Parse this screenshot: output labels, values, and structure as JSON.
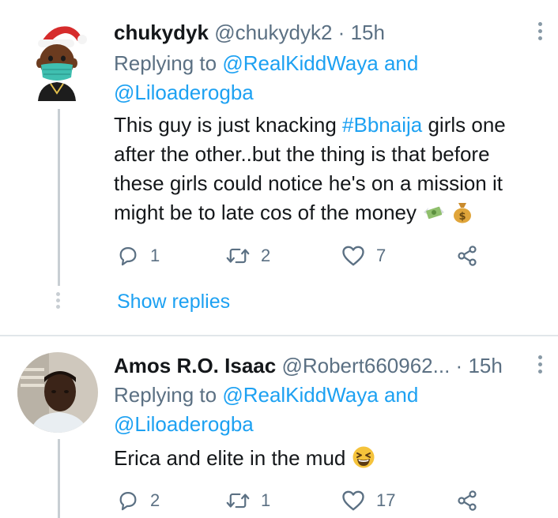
{
  "tweets": [
    {
      "name": "chukydyk",
      "handle": "@chukydyk2",
      "separator": "·",
      "time": "15h",
      "replying_prefix": "Replying to",
      "replying_user1": "@RealKiddWaya",
      "replying_and": "and",
      "replying_user2": "@Liloaderogba",
      "text_before_hashtag": "This guy is just knacking",
      "hashtag": "#Bbnaija",
      "text_after_hashtag": "girls one after the other..but the thing is that before these girls could notice he's on a mission it might be to late cos of the money",
      "emojis": [
        "money-with-wings-emoji",
        "money-bag-emoji"
      ],
      "reply_count": "1",
      "retweet_count": "2",
      "like_count": "7",
      "show_replies": "Show replies"
    },
    {
      "name": "Amos R.O. Isaac",
      "handle": "@Robert660962...",
      "separator": "·",
      "time": "15h",
      "replying_prefix": "Replying to",
      "replying_user1": "@RealKiddWaya",
      "replying_and": "and",
      "replying_user2": "@Liloaderogba",
      "text": "Erica and elite in the mud",
      "emojis": [
        "grinning-squinting-face-emoji"
      ],
      "reply_count": "2",
      "retweet_count": "1",
      "like_count": "17"
    }
  ],
  "colors": {
    "link": "#1da1f2",
    "secondary_text": "#5b7083",
    "primary_text": "#14171a",
    "thread_line": "#c8ced3",
    "separator": "#e1e6ea"
  }
}
